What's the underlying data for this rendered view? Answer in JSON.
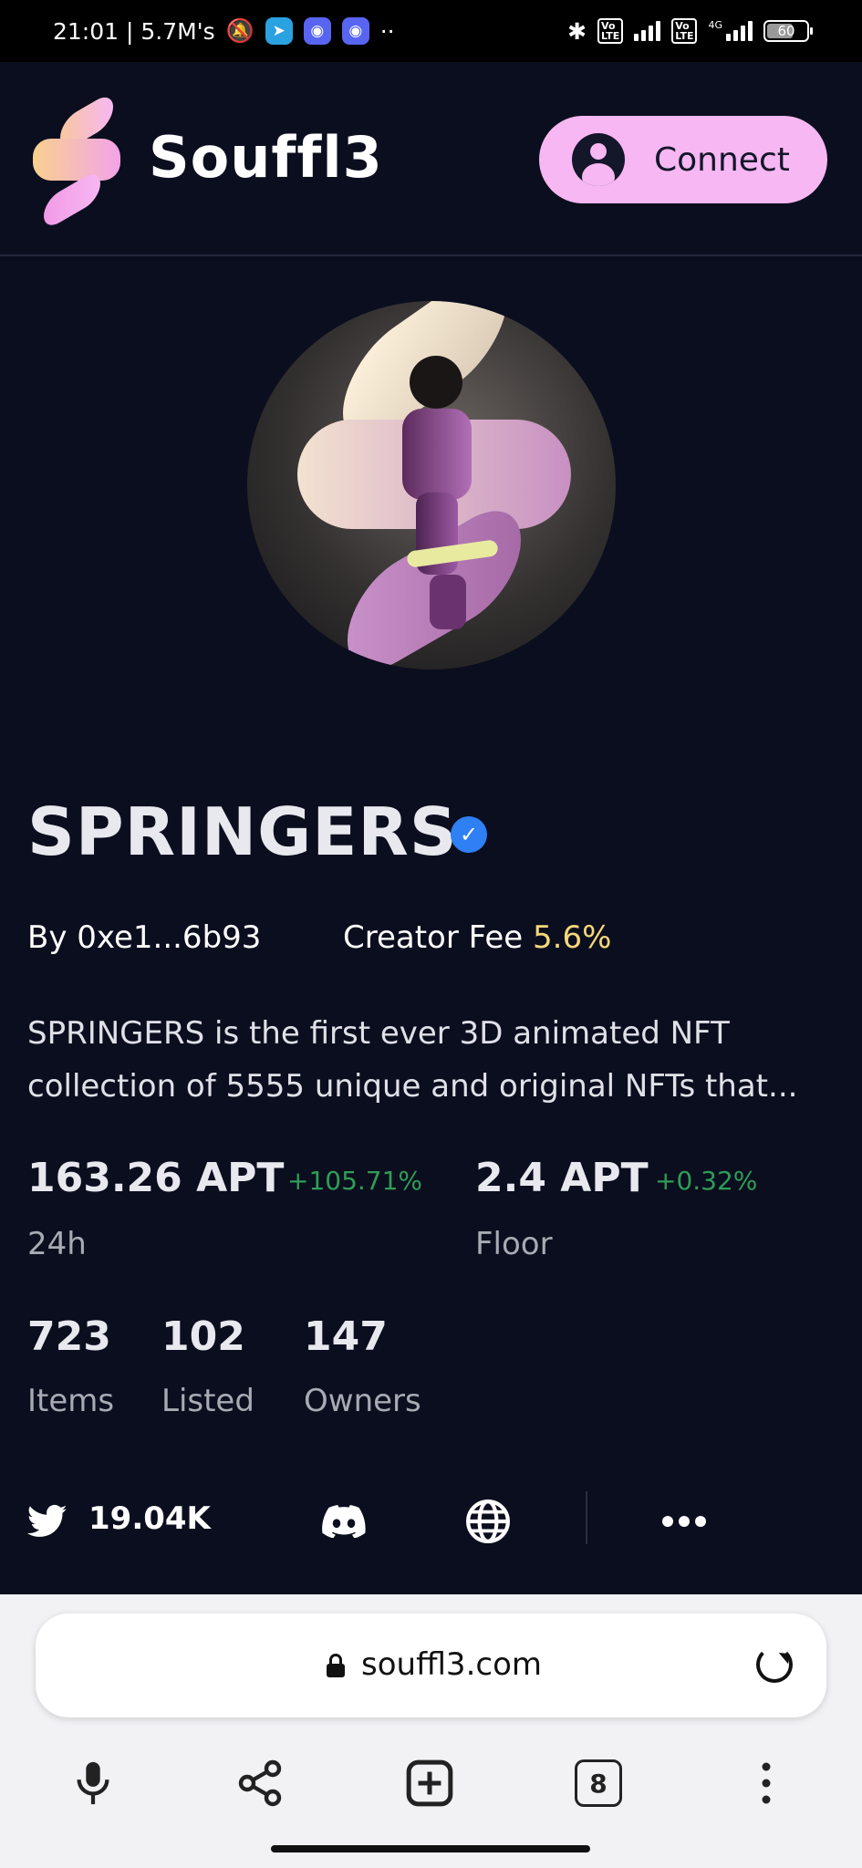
{
  "status_bar": {
    "time_speed": "21:01 | 5.7M's",
    "more": "··",
    "battery": "60",
    "network": "4G"
  },
  "header": {
    "brand": "Souffl3",
    "connect_label": "Connect"
  },
  "collection": {
    "name": "SPRINGERS",
    "creator": "By 0xe1...6b93",
    "fee_label": "Creator Fee",
    "fee_value": "5.6%",
    "description": "SPRINGERS is the first ever 3D animated NFT\ncollection of 5555 unique and original NFTs that..."
  },
  "stats": {
    "volume": {
      "value": "163.26 APT",
      "change": "+105.71%",
      "label": "24h"
    },
    "floor": {
      "value": "2.4 APT",
      "change": "+0.32%",
      "label": "Floor"
    },
    "items": {
      "value": "723",
      "label": "Items"
    },
    "listed": {
      "value": "102",
      "label": "Listed"
    },
    "owners": {
      "value": "147",
      "label": "Owners"
    }
  },
  "social": {
    "twitter_count": "19.04K",
    "icons": [
      "twitter-icon",
      "discord-icon",
      "globe-icon",
      "more-icon"
    ]
  },
  "browser": {
    "url": "souffl3.com",
    "tab_count": "8"
  },
  "colors": {
    "background": "#0b0e1e",
    "accent": "#f6b7f2",
    "fee": "#f5d77a",
    "positive": "#2e9d56",
    "verified": "#2f7ff5"
  }
}
